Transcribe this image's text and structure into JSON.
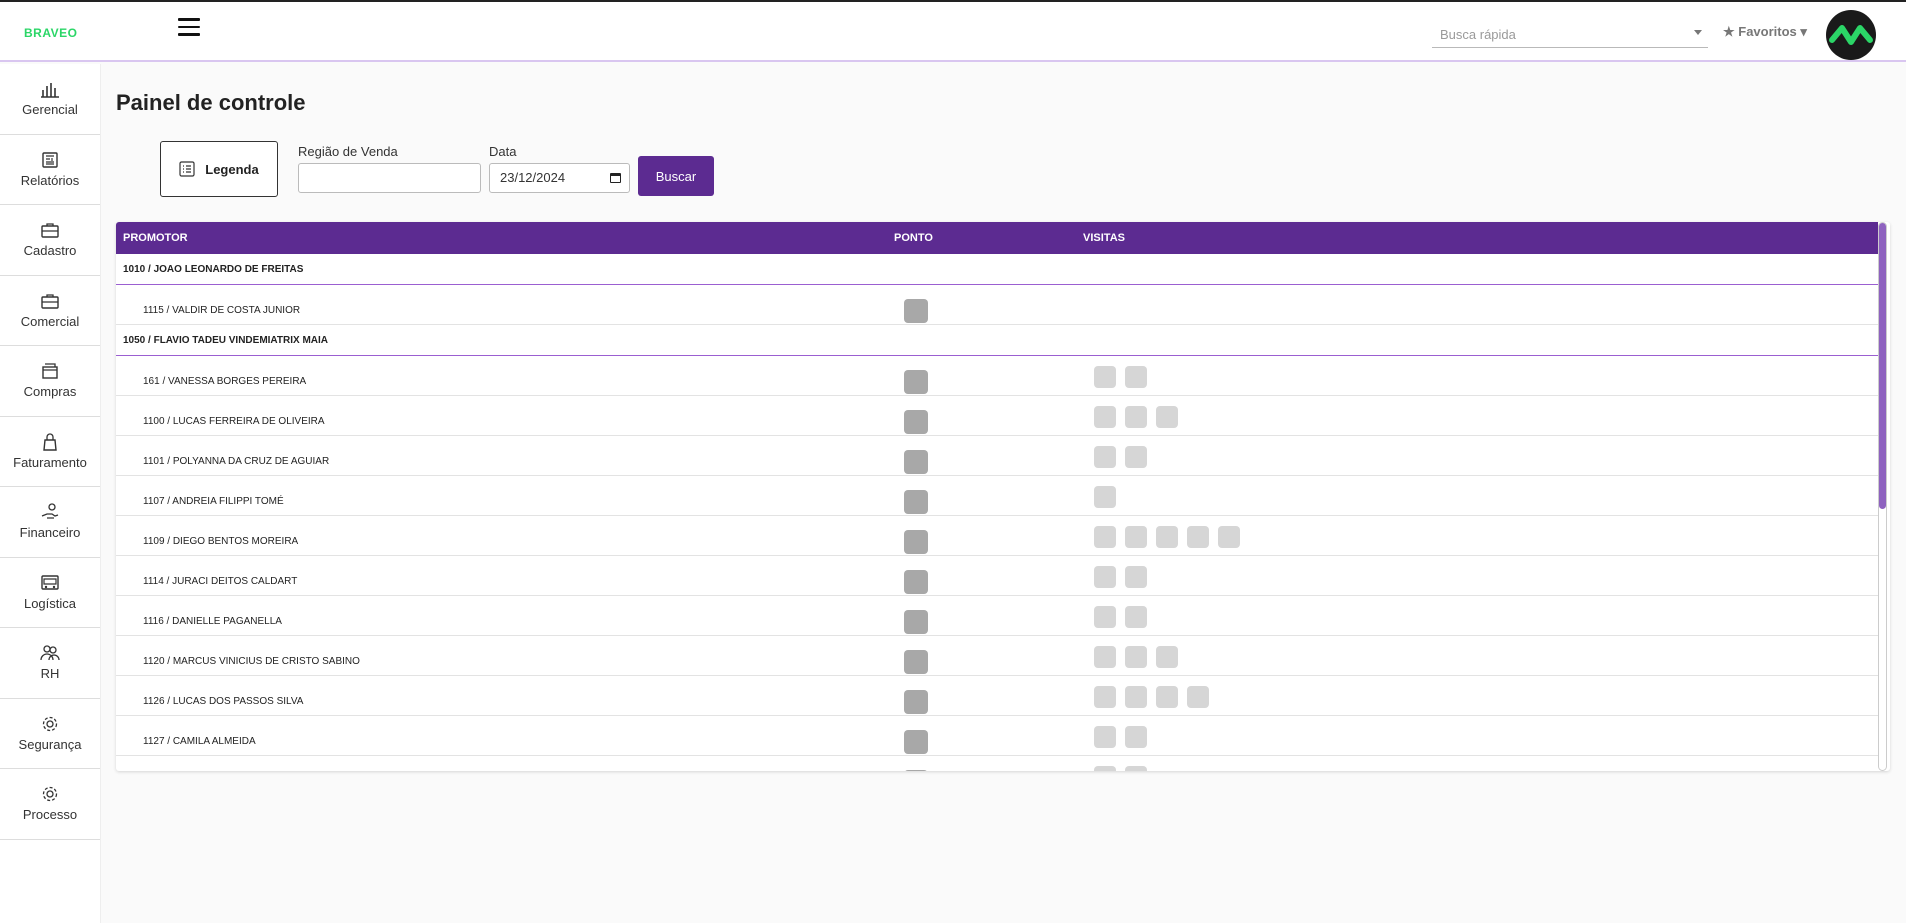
{
  "header": {
    "logo": "BRAVEO",
    "quick_search_placeholder": "Busca rápida",
    "favorites_label": "★ Favoritos ▾"
  },
  "sidebar": {
    "items": [
      {
        "label": "Gerencial",
        "icon": "bar-chart-icon"
      },
      {
        "label": "Relatórios",
        "icon": "newspaper-icon"
      },
      {
        "label": "Cadastro",
        "icon": "briefcase-icon"
      },
      {
        "label": "Comercial",
        "icon": "briefcase-icon"
      },
      {
        "label": "Compras",
        "icon": "box-icon"
      },
      {
        "label": "Faturamento",
        "icon": "bag-icon"
      },
      {
        "label": "Financeiro",
        "icon": "money-hand-icon"
      },
      {
        "label": "Logística",
        "icon": "truck-icon"
      },
      {
        "label": "RH",
        "icon": "people-icon"
      },
      {
        "label": "Segurança",
        "icon": "gear-icon"
      },
      {
        "label": "Processo",
        "icon": "gear-icon"
      }
    ]
  },
  "page": {
    "title": "Painel de controle",
    "legend_button": "Legenda",
    "region_label": "Região de Venda",
    "region_value": "",
    "date_label": "Data",
    "date_value": "23/12/2024",
    "search_button": "Buscar"
  },
  "table": {
    "headers": {
      "promotor": "PROMOTOR",
      "ponto": "PONTO",
      "visitas": "VISITAS"
    },
    "groups": [
      {
        "name": "1010 / JOAO LEONARDO DE FREITAS"
      },
      {
        "name": "1050 / FLAVIO TADEU VINDEMIATRIX MAIA"
      }
    ],
    "rows": [
      {
        "name": "1115 / VALDIR DE COSTA JUNIOR",
        "visits": 0
      },
      {
        "name": "161 / VANESSA BORGES PEREIRA",
        "visits": 2
      },
      {
        "name": "1100 / LUCAS FERREIRA DE OLIVEIRA",
        "visits": 3
      },
      {
        "name": "1101 / POLYANNA DA CRUZ DE AGUIAR",
        "visits": 2
      },
      {
        "name": "1107 / ANDREIA FILIPPI TOMÉ",
        "visits": 1
      },
      {
        "name": "1109 / DIEGO BENTOS MOREIRA",
        "visits": 5
      },
      {
        "name": "1114 / JURACI DEITOS CALDART",
        "visits": 2
      },
      {
        "name": "1116 / DANIELLE PAGANELLA",
        "visits": 2
      },
      {
        "name": "1120 / MARCUS VINICIUS DE CRISTO SABINO",
        "visits": 3
      },
      {
        "name": "1126 / LUCAS DOS PASSOS SILVA",
        "visits": 4
      },
      {
        "name": "1127 / CAMILA ALMEIDA",
        "visits": 2
      }
    ]
  },
  "colors": {
    "brand": "#5c2b91",
    "logo": "#2bd667"
  }
}
